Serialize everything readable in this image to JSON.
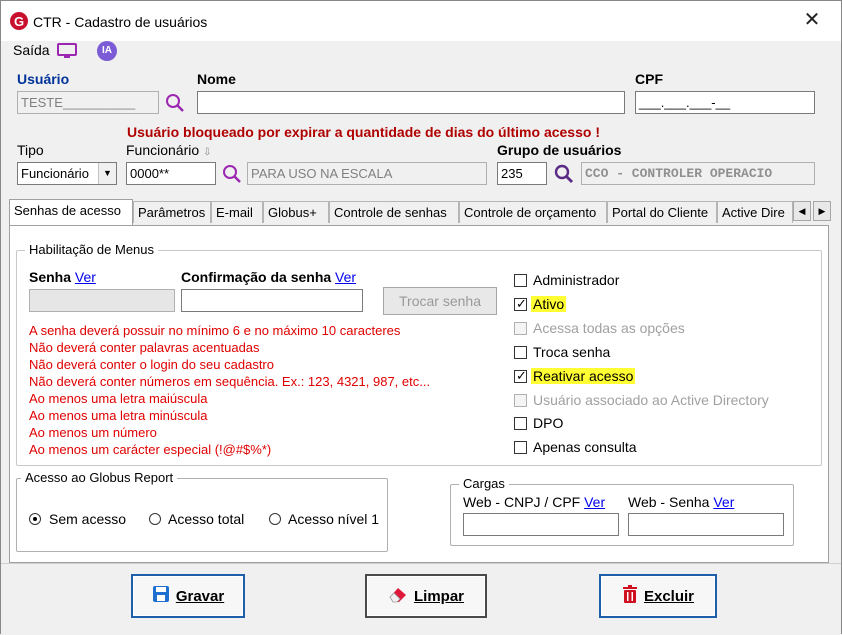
{
  "window": {
    "title": "CTR - Cadastro de usuários",
    "close": "✕"
  },
  "menu": {
    "saida": "Saída",
    "ia": "IA"
  },
  "fields": {
    "usuario_label": "Usuário",
    "usuario_value": "TESTE__________",
    "nome_label": "Nome",
    "nome_value": "",
    "cpf_label": "CPF",
    "cpf_value": "___.___.___-__",
    "warning": "Usuário bloqueado por expirar a quantidade de dias do último acesso !",
    "tipo_label": "Tipo",
    "tipo_value": "Funcionário",
    "funcionario_label": "Funcionário",
    "funcionario_value": "0000**",
    "funcionario_desc": "PARA USO NA ESCALA",
    "grupo_label": "Grupo de usuários",
    "grupo_value": "235",
    "grupo_desc": "CCO - CONTROLER OPERACIO"
  },
  "tabs": [
    "Senhas de acesso",
    "Parâmetros",
    "E-mail",
    "Globus+",
    "Controle de senhas",
    "Controle de orçamento",
    "Portal do Cliente",
    "Active Dire"
  ],
  "scroll": {
    "left": "◀",
    "right": "▶"
  },
  "habilitacao": {
    "title": "Habilitação de Menus",
    "senha_label": "Senha",
    "ver": "Ver",
    "confirmacao_label": "Confirmação da senha",
    "trocar_button": "Trocar senha",
    "rules": [
      "A senha deverá possuir no mínimo 6 e no máximo 10 caracteres",
      "Não deverá conter palavras acentuadas",
      "Não deverá conter o login do seu cadastro",
      "Não deverá conter números em sequência. Ex.: 123, 4321, 987, etc...",
      "Ao menos uma letra maiúscula",
      "Ao menos uma letra minúscula",
      "Ao menos um número",
      "Ao menos um carácter especial (!@#$%*)"
    ],
    "checks": [
      {
        "label": "Administrador",
        "checked": false,
        "disabled": false,
        "highlight": false
      },
      {
        "label": "Ativo",
        "checked": true,
        "disabled": false,
        "highlight": true
      },
      {
        "label": "Acessa todas as opções",
        "checked": false,
        "disabled": true,
        "highlight": false
      },
      {
        "label": "Troca senha",
        "checked": false,
        "disabled": false,
        "highlight": false
      },
      {
        "label": "Reativar acesso",
        "checked": true,
        "disabled": false,
        "highlight": true
      },
      {
        "label": "Usuário associado ao Active Directory",
        "checked": false,
        "disabled": true,
        "highlight": false
      },
      {
        "label": "DPO",
        "checked": false,
        "disabled": false,
        "highlight": false
      },
      {
        "label": "Apenas consulta",
        "checked": false,
        "disabled": false,
        "highlight": false
      }
    ]
  },
  "report": {
    "title": "Acesso ao Globus Report",
    "options": [
      "Sem acesso",
      "Acesso total",
      "Acesso nível 1"
    ],
    "selected": 0
  },
  "cargas": {
    "title": "Cargas",
    "cnpj_label": "Web - CNPJ / CPF",
    "senha_label": "Web - Senha",
    "ver": "Ver"
  },
  "buttons": {
    "gravar": "Gravar",
    "limpar": "Limpar",
    "excluir": "Excluir"
  },
  "colors": {
    "accent_blue": "#1f5ea8",
    "warning_red": "#b00000",
    "rule_red": "#e00000",
    "highlight": "#ffff33"
  }
}
